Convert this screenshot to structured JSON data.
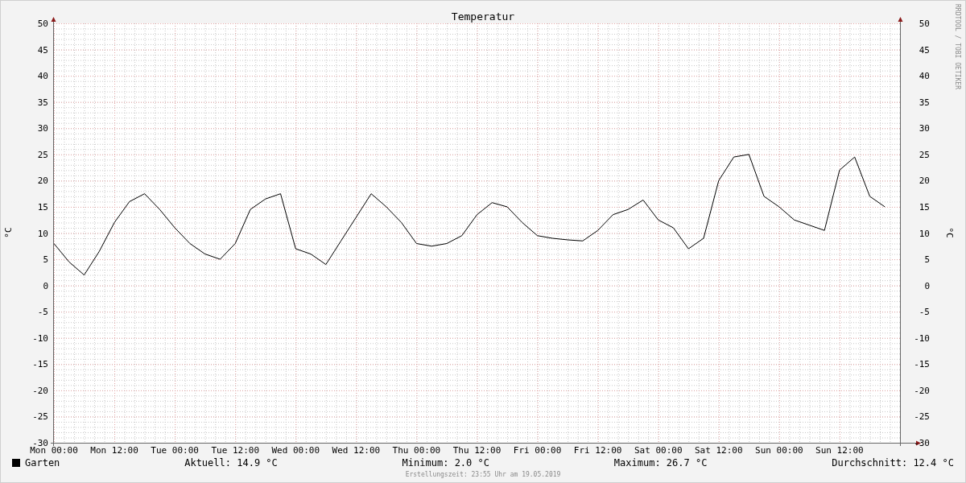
{
  "chart": {
    "credit": "RRDTOOL / TOBI OETIKER",
    "right_yticks": [
      "50",
      "45",
      "40",
      "35",
      "30",
      "25",
      "20",
      "15",
      "10",
      "5",
      "0",
      "-5",
      "-10",
      "-15",
      "-20",
      "-25",
      "-30"
    ],
    "chart_data": {
      "type": "line",
      "title": "Temperatur",
      "ylabel": "°C",
      "grid": true,
      "ylim": [
        -30,
        50
      ],
      "yticks": [
        -30,
        -25,
        -20,
        -15,
        -10,
        -5,
        0,
        5,
        10,
        15,
        20,
        25,
        30,
        35,
        40,
        45,
        50
      ],
      "categories": [
        "Mon 00:00",
        null,
        null,
        null,
        "Mon 12:00",
        null,
        null,
        null,
        "Tue 00:00",
        null,
        null,
        null,
        "Tue 12:00",
        null,
        null,
        null,
        "Wed 00:00",
        null,
        null,
        null,
        "Wed 12:00",
        null,
        null,
        null,
        "Thu 00:00",
        null,
        null,
        null,
        "Thu 12:00",
        null,
        null,
        null,
        "Fri 00:00",
        null,
        null,
        null,
        "Fri 12:00",
        null,
        null,
        null,
        "Sat 00:00",
        null,
        null,
        null,
        "Sat 12:00",
        null,
        null,
        null,
        "Sun 00:00",
        null,
        null,
        null,
        "Sun 12:00",
        null,
        null,
        null
      ],
      "series": [
        {
          "name": "Garten",
          "color": "#000000",
          "values": [
            8,
            4.5,
            2,
            6.5,
            12,
            16,
            17.5,
            14.5,
            11,
            8,
            6,
            5,
            8,
            14.5,
            16.5,
            17.5,
            7,
            6,
            4,
            8.5,
            13,
            17.5,
            15,
            12,
            8,
            7.5,
            8,
            9.5,
            13.5,
            15.8,
            15,
            12,
            9.5,
            9,
            8.7,
            8.5,
            10.5,
            13.5,
            14.5,
            16.3,
            12.5,
            11,
            7,
            9,
            20,
            24.5,
            25,
            17,
            15,
            12.5,
            11.5,
            10.5,
            22,
            24.5,
            17,
            15
          ]
        }
      ]
    }
  },
  "legend": {
    "stats": [
      "Aktuell: 14.9 °C",
      "Minimum: 2.0 °C",
      "Maximum: 26.7 °C",
      "Durchschnitt: 12.4 °C"
    ]
  },
  "footer": "Erstellungszeit: 23:55 Uhr am 19.05.2019"
}
